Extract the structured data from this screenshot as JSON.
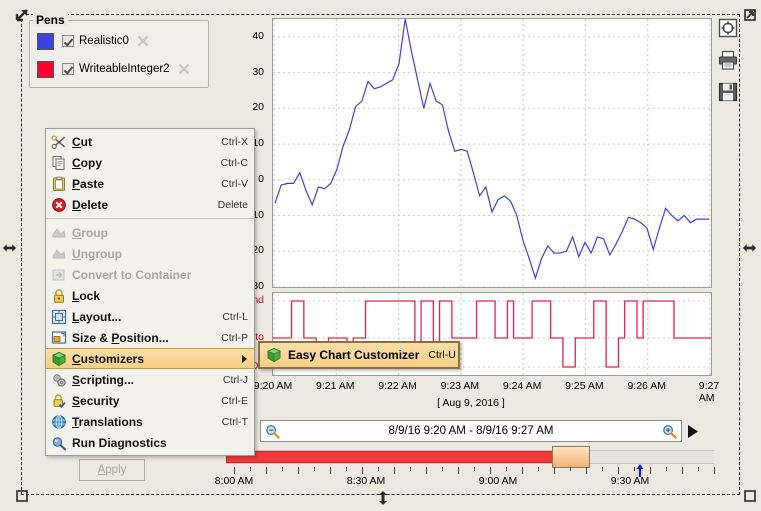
{
  "pens": {
    "title": "Pens",
    "items": [
      {
        "name": "Realistic0",
        "color": "#4040e0",
        "checked": true,
        "delete_icon": "x-delete-icon"
      },
      {
        "name": "WriteableInteger2",
        "color": "#ff0030",
        "checked": true,
        "delete_icon": "x-delete-icon"
      }
    ]
  },
  "context_menu": {
    "items": [
      {
        "label": "Cut",
        "mnemonic": "C",
        "accel": "Ctrl-X",
        "icon": "scissors-icon",
        "enabled": true
      },
      {
        "label": "Copy",
        "mnemonic": "C",
        "accel": "Ctrl-C",
        "icon": "copy-icon",
        "enabled": true
      },
      {
        "label": "Paste",
        "mnemonic": "P",
        "accel": "Ctrl-V",
        "icon": "clipboard-icon",
        "enabled": true
      },
      {
        "label": "Delete",
        "mnemonic": "D",
        "accel": "Delete",
        "icon": "delete-icon",
        "enabled": true
      },
      {
        "separator": true
      },
      {
        "label": "Group",
        "mnemonic": "G",
        "accel": "",
        "icon": "group-icon",
        "enabled": false
      },
      {
        "label": "Ungroup",
        "mnemonic": "U",
        "accel": "",
        "icon": "ungroup-icon",
        "enabled": false
      },
      {
        "label": "Convert to Container",
        "mnemonic": "",
        "accel": "",
        "icon": "container-icon",
        "enabled": false
      },
      {
        "label": "Lock",
        "mnemonic": "L",
        "accel": "",
        "icon": "lock-icon",
        "enabled": true
      },
      {
        "label": "Layout...",
        "mnemonic": "L",
        "accel": "Ctrl-L",
        "icon": "layout-icon",
        "enabled": true
      },
      {
        "label": "Size & Position...",
        "mnemonic": "P",
        "accel": "Ctrl-P",
        "icon": "size-position-icon",
        "enabled": true
      },
      {
        "label": "Customizers",
        "mnemonic": "C",
        "accel": "",
        "icon": "customizers-icon",
        "enabled": true,
        "selected": true,
        "has_submenu": true
      },
      {
        "label": "Scripting...",
        "mnemonic": "S",
        "accel": "Ctrl-J",
        "icon": "scripting-icon",
        "enabled": true
      },
      {
        "label": "Security",
        "mnemonic": "S",
        "accel": "Ctrl-E",
        "icon": "security-icon",
        "enabled": true
      },
      {
        "label": "Translations",
        "mnemonic": "T",
        "accel": "Ctrl-T",
        "icon": "translations-icon",
        "enabled": true
      },
      {
        "label": "Run Diagnostics",
        "mnemonic": "",
        "accel": "",
        "icon": "diagnostics-icon",
        "enabled": true
      }
    ]
  },
  "submenu": {
    "label": "Easy Chart Customizer",
    "accel": "Ctrl-U",
    "icon": "customizers-icon"
  },
  "toolbar": {
    "buttons": [
      {
        "name": "zoom-fit-icon",
        "title": "Zoom"
      },
      {
        "name": "print-icon",
        "title": "Print"
      },
      {
        "name": "save-icon",
        "title": "Save"
      }
    ]
  },
  "range": {
    "value": "8/9/16 9:20 AM - 8/9/16 9:27 AM",
    "zoom_out_icon": "zoom-out-icon",
    "zoom_in_icon": "zoom-in-icon",
    "play_icon": "play-icon"
  },
  "timeline": {
    "labels": [
      "8:00 AM",
      "8:30 AM",
      "9:00 AM",
      "9:30 AM"
    ],
    "label_positions": [
      8,
      140,
      272,
      404
    ],
    "selection_left": 326,
    "selection_width": 38,
    "marker_position": 414
  },
  "apply_button": {
    "label": "Apply",
    "mnemonic": "A",
    "enabled": false
  },
  "chart_data": {
    "type": "line",
    "title": "",
    "xlabel": "[ Aug 9, 2016 ]",
    "ylabel": "",
    "grid": true,
    "legend_position": "top-left",
    "x_tick_labels": [
      "9:20 AM",
      "9:21 AM",
      "9:22 AM",
      "9:23 AM",
      "9:24 AM",
      "9:25 AM",
      "9:26 AM",
      "9:27 AM"
    ],
    "subplots": [
      {
        "name": "analog",
        "ylim": [
          -30,
          45
        ],
        "y_tick_labels": [
          "40",
          "30",
          "20",
          "10",
          "0",
          "-10",
          "-20",
          "-30"
        ],
        "y_ticks": [
          40,
          30,
          20,
          10,
          0,
          -10,
          -20,
          -30
        ],
        "series": [
          {
            "name": "Realistic0",
            "color": "#4040e0",
            "values": [
              -6.5,
              -1.5,
              -1.0,
              -1.0,
              2.0,
              -3.0,
              -7.0,
              -2.0,
              -2.5,
              -1.0,
              3.0,
              9.5,
              14.0,
              20.5,
              22.0,
              27.5,
              25.5,
              26.0,
              27.0,
              28.0,
              32.5,
              45.0,
              36.0,
              28.0,
              20.0,
              27.0,
              22.0,
              21.0,
              13.5,
              8.0,
              8.5,
              8.0,
              2.0,
              -4.5,
              -2.0,
              -9.0,
              -5.5,
              -4.5,
              -6.0,
              -10.0,
              -17.0,
              -22.0,
              -27.5,
              -22.0,
              -18.5,
              -20.5,
              -20.5,
              -20.0,
              -16.0,
              -21.5,
              -17.5,
              -20.5,
              -16.0,
              -16.5,
              -21.0,
              -18.0,
              -14.5,
              -10.5,
              -11.0,
              -12.0,
              -13.5,
              -19.5,
              -13.5,
              -8.0,
              -10.0,
              -11.5,
              -10.0,
              -12.0,
              -11.0,
              -11.0,
              -11.0
            ]
          }
        ]
      },
      {
        "name": "digital",
        "y_tick_labels": [
          "Hand",
          "Auto",
          "Off"
        ],
        "series": [
          {
            "name": "WriteableInteger2",
            "color": "#e8204a",
            "type": "step",
            "levels": [
              1,
              1,
              1,
              2,
              2,
              1,
              1,
              0,
              0,
              1,
              1,
              1,
              0,
              1,
              1,
              2,
              2,
              2,
              2,
              2,
              2,
              2,
              2,
              0,
              2,
              2,
              0,
              2,
              2,
              1,
              1,
              1,
              1,
              2,
              2,
              2,
              1,
              1,
              2,
              1,
              1,
              1,
              2,
              2,
              2,
              1,
              1,
              0,
              0,
              1,
              1,
              1,
              2,
              2,
              0,
              0,
              1,
              2,
              2,
              1,
              2,
              2,
              2,
              2,
              2,
              1,
              1,
              1,
              1,
              1,
              1
            ]
          }
        ]
      }
    ]
  }
}
